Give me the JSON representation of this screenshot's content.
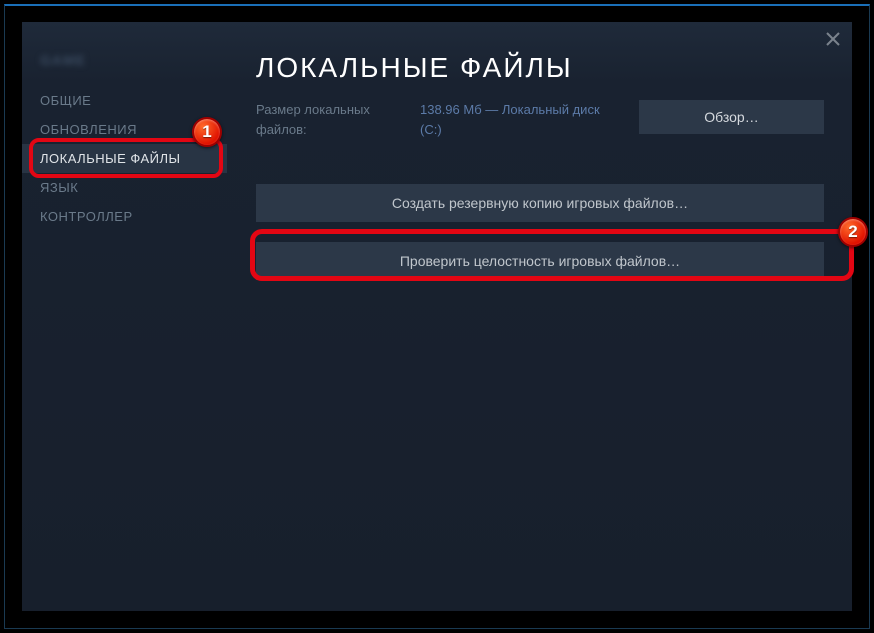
{
  "gameLabel": "GAME",
  "nav": {
    "items": [
      {
        "label": "ОБЩИЕ"
      },
      {
        "label": "ОБНОВЛЕНИЯ"
      },
      {
        "label": "ЛОКАЛЬНЫЕ ФАЙЛЫ"
      },
      {
        "label": "ЯЗЫК"
      },
      {
        "label": "КОНТРОЛЛЕР"
      }
    ]
  },
  "content": {
    "title": "ЛОКАЛЬНЫЕ ФАЙЛЫ",
    "sizeLabel": "Размер локальных файлов:",
    "sizeValue": "138.96 Мб — Локальный диск (C:)",
    "browseBtn": "Обзор…",
    "backupBtn": "Создать резервную копию игровых файлов…",
    "verifyBtn": "Проверить целостность игровых файлов…"
  },
  "markers": {
    "m1": "1",
    "m2": "2"
  }
}
